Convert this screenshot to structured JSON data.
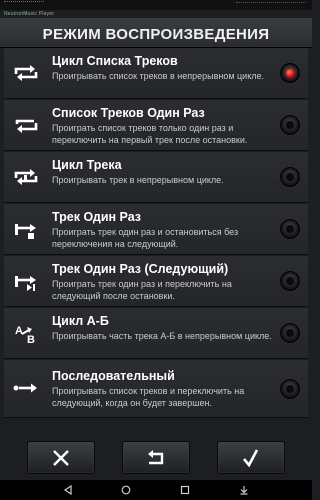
{
  "app": {
    "name": "NeutronMusic Player"
  },
  "header": {
    "title": "РЕЖИМ ВОСПРОИЗВЕДЕНИЯ"
  },
  "modes": [
    {
      "name": "Цикл Списка Треков",
      "desc": "Проигрывать список треков в непрерывном цикле.",
      "icon": "repeat-all-icon",
      "selected": true
    },
    {
      "name": "Список Треков Один Раз",
      "desc": "Проиграть список треков только один раз и переключить на первый трек после остановки.",
      "icon": "playlist-once-icon",
      "selected": false
    },
    {
      "name": "Цикл Трека",
      "desc": "Проигрывать трек в непрерывном цикле.",
      "icon": "repeat-one-icon",
      "selected": false
    },
    {
      "name": "Трек Один Раз",
      "desc": "Проиграть трек один раз и остановиться без переключения на следующий.",
      "icon": "track-once-stop-icon",
      "selected": false
    },
    {
      "name": "Трек Один Раз (Следующий)",
      "desc": "Проиграть трек один раз и переключить на следующий после остановки.",
      "icon": "track-once-next-icon",
      "selected": false
    },
    {
      "name": "Цикл А-Б",
      "desc": "Проигрывать часть трека А-Б в непрерывном цикле.",
      "icon": "ab-loop-icon",
      "selected": false
    },
    {
      "name": "Последовательный",
      "desc": "Проигрывать список треков и переключить на следующий, когда он будет завершен.",
      "icon": "sequential-icon",
      "selected": false
    }
  ],
  "buttons": {
    "cancel": "close-icon",
    "reset": "undo-icon",
    "confirm": "checkmark-icon"
  },
  "colors": {
    "accent": "#e8170b",
    "background": "#1c1e21",
    "row": "#2b2d31"
  }
}
